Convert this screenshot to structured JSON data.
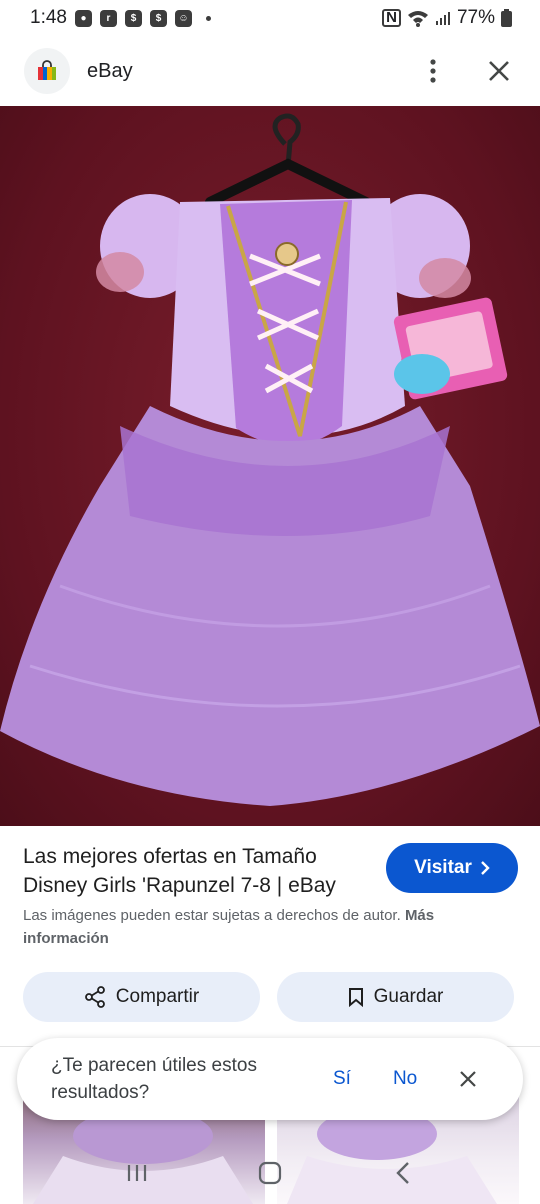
{
  "status_bar": {
    "time": "1:48",
    "notif_icons": [
      "chat-bubble-icon",
      "ring-icon",
      "tag-icon",
      "tag-icon",
      "smiley-icon"
    ],
    "battery": "77%"
  },
  "app_bar": {
    "title": "eBay",
    "favicon": "shopping-bag-icon",
    "menu_icon": "more-vert-icon",
    "close_icon": "close-icon"
  },
  "result": {
    "title": "Las mejores ofertas en Tamaño Disney Girls 'Rapunzel 7-8 | eBay",
    "visit_label": "Visitar",
    "copyright_text": "Las imágenes pueden estar sujetas a derechos de autor.",
    "more_info_label": "Más información",
    "share_label": "Compartir",
    "save_label": "Guardar"
  },
  "feedback": {
    "question": "¿Te parecen útiles estos resultados?",
    "yes_label": "Sí",
    "no_label": "No"
  },
  "colors": {
    "accent": "#0b57d0",
    "chip_bg": "#e8eef9",
    "hero_bg": "#5e1220",
    "dress": "#b48ad6"
  }
}
